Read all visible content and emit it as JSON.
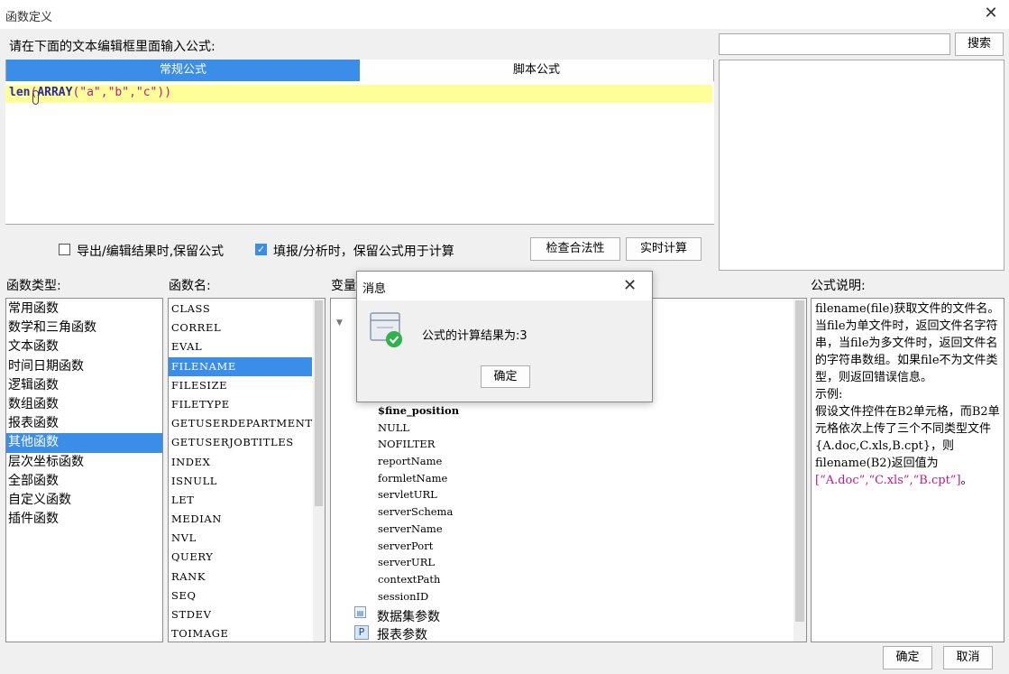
{
  "window": {
    "title": "函数定义"
  },
  "prompt_label": "请在下面的文本编辑框里面输入公式:",
  "search": {
    "value": "",
    "button_label": "搜索"
  },
  "tabs": [
    {
      "label": "常规公式",
      "active": true
    },
    {
      "label": "脚本公式",
      "active": false
    }
  ],
  "formula": {
    "fn": "len",
    "cursor": "(",
    "inner_fn": "ARRAY",
    "open": "(",
    "args": "\"a\",\"b\",\"c\"",
    "close": "))"
  },
  "options": {
    "keep_on_export": {
      "label": "导出/编辑结果时,保留公式",
      "checked": false
    },
    "keep_on_fill": {
      "label": "填报/分析时，保留公式用于计算",
      "checked": true
    }
  },
  "buttons": {
    "check": "检查合法性",
    "realtime": "实时计算",
    "ok": "确定",
    "cancel": "取消"
  },
  "headers": {
    "category": "函数类型:",
    "function": "函数名:",
    "variable": "变量",
    "description": "公式说明:"
  },
  "categories": [
    "常用函数",
    "数学和三角函数",
    "文本函数",
    "时间日期函数",
    "逻辑函数",
    "数组函数",
    "报表函数",
    "其他函数",
    "层次坐标函数",
    "全部函数",
    "自定义函数",
    "插件函数"
  ],
  "selected_category": "其他函数",
  "functions": [
    "CLASS",
    "CORREL",
    "EVAL",
    "FILENAME",
    "FILESIZE",
    "FILETYPE",
    "GETUSERDEPARTMENTS",
    "GETUSERJOBTITLES",
    "INDEX",
    "ISNULL",
    "LET",
    "MEDIAN",
    "NVL",
    "QUERY",
    "RANK",
    "SEQ",
    "STDEV",
    "TOIMAGE"
  ],
  "selected_function": "FILENAME",
  "variables": [
    "$fine_position",
    "NULL",
    "NOFILTER",
    "reportName",
    "formletName",
    "servletURL",
    "serverSchema",
    "serverName",
    "serverPort",
    "serverURL",
    "contextPath",
    "sessionID"
  ],
  "var_groups": [
    {
      "label": "数据集参数",
      "icon": "dataset-icon"
    },
    {
      "label": "报表参数",
      "icon": "param-icon",
      "glyph": "P"
    }
  ],
  "description": {
    "main": "filename(file)获取文件的文件名。当file为单文件时，返回文件名字符串，当file为多文件时，返回文件名的字符串数组。如果file不为文件类型，则返回错误信息。",
    "example_title": "示例:",
    "example_body": "假设文件控件在B2单元格，而B2单元格依次上传了三个不同类型文件{A.doc,C.xls,B.cpt}，则filename(B2)返回值为",
    "example_result": "[“A.doc”,“C.xls”,“B.cpt”]",
    "example_end": "。"
  },
  "dialog": {
    "title": "消息",
    "message": "公式的计算结果为:3",
    "ok": "确定"
  },
  "colors": {
    "accent": "#3b8ee8",
    "highlight_line": "#ffff99",
    "keyword": "#2a2aa8",
    "string": "#c0188b",
    "success": "#2fb24a"
  }
}
